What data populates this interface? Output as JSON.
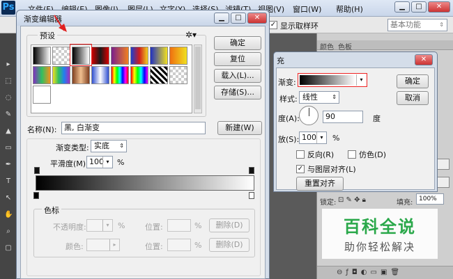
{
  "colors": {
    "accent_red": "#e02020",
    "title_blue": "#c9d6e8",
    "watermark_green": "#2aa84a"
  },
  "ps": {
    "logo": "Ps",
    "menus": [
      "文件(F)",
      "编辑(E)",
      "图像(I)",
      "图层(L)",
      "文字(Y)",
      "选择(S)",
      "滤镜(T)",
      "视图(V)",
      "窗口(W)",
      "帮助(H)"
    ],
    "window_controls": {
      "min": "▁",
      "max": "□",
      "close": "✕"
    },
    "options_bar": {
      "sample_ring_label": "显示取样环",
      "sample_ring_checked": true,
      "workspace": "基本功能"
    },
    "panels": {
      "tabs": [
        "颜色",
        "色板"
      ],
      "lock_label": "锁定:",
      "fill_label": "填充:",
      "fill_value": "100%"
    }
  },
  "gradient_editor": {
    "title": "渐变编辑器",
    "presets_label": "预设",
    "settings_icon": "gear-icon",
    "buttons": {
      "ok": "确定",
      "reset": "复位",
      "load": "载入(L)...",
      "save": "存储(S)...",
      "new": "新建(W)"
    },
    "name_label": "名称(N):",
    "name_value": "黑, 白渐变",
    "gradient_type_label": "渐变类型:",
    "gradient_type_value": "实底",
    "smoothness_label": "平滑度(M):",
    "smoothness_value": "100",
    "smoothness_unit": "%",
    "stops_group_label": "色标",
    "opacity_label": "不透明度:",
    "opacity_unit": "%",
    "location_label": "位置:",
    "location_unit": "%",
    "delete_label": "删除(D)",
    "color_label": "颜色:",
    "presets": [
      "linear-gradient(90deg,#000,#fff)",
      "linear-gradient(90deg,#000,transparent)",
      "linear-gradient(90deg,#000,#fff)",
      "linear-gradient(90deg,#c00,#1a1a1a,#d00)",
      "linear-gradient(90deg,#7a1f8c,#f08020)",
      "linear-gradient(90deg,#1c3fd0,#d01c1c,#f0d020)",
      "linear-gradient(90deg,#2030c0,#f0e020)",
      "linear-gradient(90deg,#f07010,#f0e020)",
      "linear-gradient(90deg,#8030c0,#30c060,#f09020)",
      "linear-gradient(90deg,#f0e020,#30c060,#2080f0,#a030c0)",
      "linear-gradient(90deg,#804020,#f0c090,#804020)",
      "linear-gradient(90deg,#3050d0,#fff,#3050d0)",
      "linear-gradient(90deg,#f00,#ff0,#0f0,#0ff,#00f,#f0f,#f00)",
      "linear-gradient(90deg,#f00,#ff0,#0f0,#0ff,#00f,#f0f)",
      "repeating-linear-gradient(45deg,#000 0 3px,#fff 3px 6px)",
      "linear-gradient(90deg,#888,transparent)",
      "linear-gradient(90deg,#fff,#fff)"
    ]
  },
  "gradient_overlay": {
    "title_fragment": "充",
    "gradient_label": "渐变:",
    "style_label": "样式:",
    "style_value": "线性",
    "angle_label": "度(A):",
    "angle_value": "90",
    "angle_unit": "度",
    "scale_label": "放(S):",
    "scale_value": "100",
    "scale_unit": "%",
    "reverse_label": "反向(R)",
    "dither_label": "仿色(D)",
    "align_label": "与图层对齐(L)",
    "reverse_checked": false,
    "dither_checked": false,
    "align_checked": true,
    "reset_alignment": "重置对齐",
    "ok": "确定",
    "cancel": "取消"
  },
  "watermark": {
    "title": "百科全说",
    "subtitle": "助你轻松解决"
  }
}
